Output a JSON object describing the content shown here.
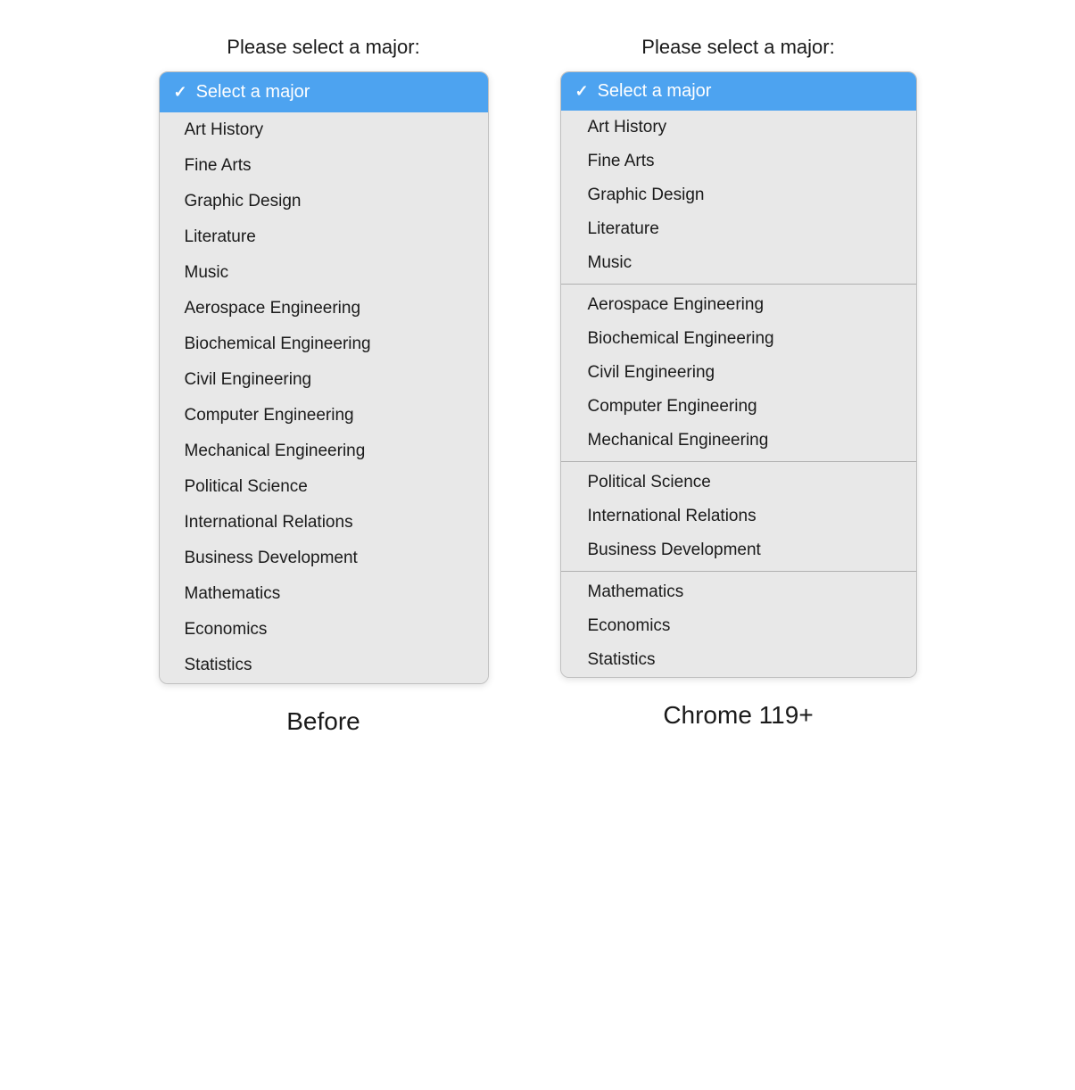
{
  "before": {
    "label": "Please select a major:",
    "caption": "Before",
    "selected": "Select a major",
    "items": [
      "Art History",
      "Fine Arts",
      "Graphic Design",
      "Literature",
      "Music",
      "Aerospace Engineering",
      "Biochemical Engineering",
      "Civil Engineering",
      "Computer Engineering",
      "Mechanical Engineering",
      "Political Science",
      "International Relations",
      "Business Development",
      "Mathematics",
      "Economics",
      "Statistics"
    ]
  },
  "after": {
    "label": "Please select a major:",
    "caption": "Chrome 119+",
    "selected": "Select a major",
    "groups": [
      {
        "items": [
          "Art History",
          "Fine Arts",
          "Graphic Design",
          "Literature",
          "Music"
        ]
      },
      {
        "items": [
          "Aerospace Engineering",
          "Biochemical Engineering",
          "Civil Engineering",
          "Computer Engineering",
          "Mechanical Engineering"
        ]
      },
      {
        "items": [
          "Political Science",
          "International Relations",
          "Business Development"
        ]
      },
      {
        "items": [
          "Mathematics",
          "Economics",
          "Statistics"
        ]
      }
    ]
  },
  "icons": {
    "checkmark": "✓"
  }
}
